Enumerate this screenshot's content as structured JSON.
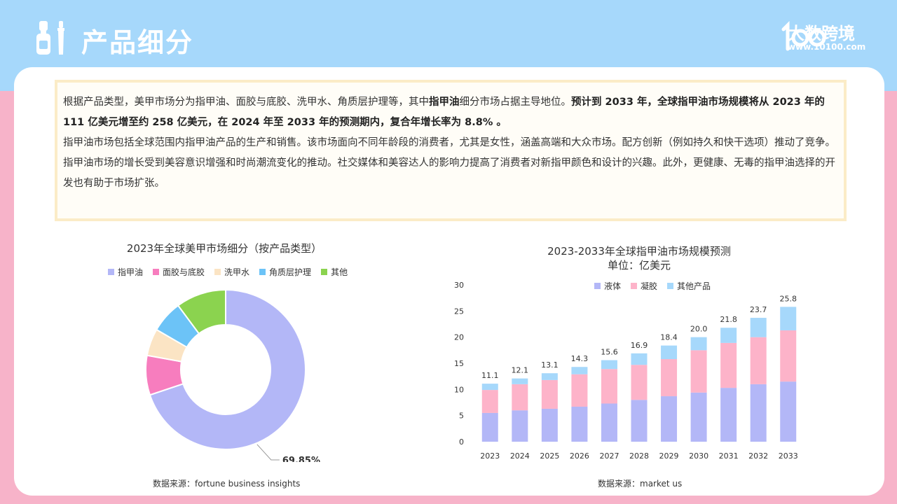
{
  "header": {
    "title": "产品细分",
    "logo_text": "大数跨境",
    "logo_url": "www.10100.com"
  },
  "intro": {
    "p1_a": "根据产品类型，美甲市场分为指甲油、面胶与底胶、洗甲水、角质层护理等，其中",
    "p1_b": "指甲油",
    "p1_c": "细分市场占据主导地位。",
    "p1_d": "预计到 2033 年，全球指甲油市场规模将从 2023 年的 111 亿美元增至约 258 亿美元，在 2024 年至 2033 年的预测期内，复合年增长率为 8.8% 。",
    "p2": "指甲油市场包括全球范围内指甲油产品的生产和销售。该市场面向不同年龄段的消费者，尤其是女性，涵盖高端和大众市场。配方创新（例如持久和快干选项）推动了竞争。",
    "p3": "指甲油市场的增长受到美容意识增强和时尚潮流变化的推动。社交媒体和美容达人的影响力提高了消费者对新指甲颜色和设计的兴趣。此外，更健康、无毒的指甲油选择的开发也有助于市场扩张。"
  },
  "colors": {
    "liquid": "#b3b7f7",
    "gel": "#fdb3c9",
    "other": "#a6d8fb",
    "polish": "#b3b7f7",
    "basecoat": "#f77dbe",
    "remover": "#fbe4c4",
    "cuticle": "#6cc3f7",
    "others": "#8bd34f"
  },
  "chart_data": [
    {
      "type": "pie",
      "title": "2023年全球美甲市场细分（按产品类型）",
      "legend_position": "top",
      "categories": [
        "指甲油",
        "面胶与底胶",
        "洗甲水",
        "角质层护理",
        "其他"
      ],
      "values": [
        69.85,
        8,
        5.5,
        6.5,
        10.15
      ],
      "data_labels": [
        "69.85%"
      ],
      "source": "数据来源：fortune business insights"
    },
    {
      "type": "bar",
      "stacked": true,
      "title": "2023-2033年全球指甲油市场规模预测",
      "subtitle": "单位：亿美元",
      "legend_position": "top",
      "categories": [
        "2023",
        "2024",
        "2025",
        "2026",
        "2027",
        "2028",
        "2029",
        "2030",
        "2031",
        "2032",
        "2033"
      ],
      "series": [
        {
          "name": "液体",
          "values": [
            5.5,
            6.0,
            6.3,
            6.7,
            7.3,
            8.0,
            8.7,
            9.4,
            10.3,
            11.0,
            11.5
          ]
        },
        {
          "name": "凝胶",
          "values": [
            4.4,
            5.0,
            5.5,
            6.2,
            6.6,
            6.7,
            7.1,
            8.1,
            8.6,
            9.0,
            9.8
          ]
        },
        {
          "name": "其他产品",
          "values": [
            1.2,
            1.1,
            1.3,
            1.4,
            1.7,
            2.2,
            2.6,
            2.5,
            2.9,
            3.7,
            4.5
          ]
        }
      ],
      "totals": [
        "11.1",
        "12.1",
        "13.1",
        "14.3",
        "15.6",
        "16.9",
        "18.4",
        "20.0",
        "21.8",
        "23.7",
        "25.8"
      ],
      "y_ticks": [
        "0",
        "5",
        "10",
        "15",
        "20",
        "25",
        "30"
      ],
      "ylim": [
        0,
        30
      ],
      "grid": false,
      "source": "数据来源：market us"
    }
  ]
}
